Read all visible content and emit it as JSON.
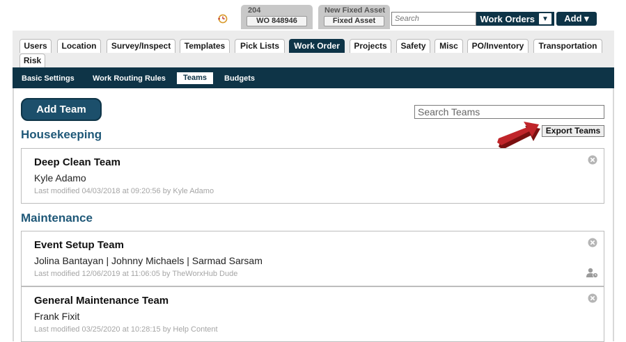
{
  "topbar": {
    "icons": {
      "history": "history-clock-icon"
    },
    "recent": [
      {
        "top": "204",
        "box": "WO 848946"
      },
      {
        "top": "New Fixed Asset",
        "box": "Fixed Asset"
      }
    ],
    "search_placeholder": "Search",
    "work_orders_label": "Work Orders",
    "work_orders_arrow": "▼",
    "add_label": "Add ▾"
  },
  "tabs": [
    {
      "label": "Users"
    },
    {
      "label": "Location"
    },
    {
      "label": "Survey/Inspect"
    },
    {
      "label": "Templates"
    },
    {
      "label": "Pick Lists"
    },
    {
      "label": "Work Order",
      "active": true
    },
    {
      "label": "Projects"
    },
    {
      "label": "Safety"
    },
    {
      "label": "Misc"
    },
    {
      "label": "PO/Inventory"
    },
    {
      "label": "Transportation"
    },
    {
      "label": "Risk"
    }
  ],
  "subnav": [
    {
      "label": "Basic Settings"
    },
    {
      "label": "Work Routing Rules"
    },
    {
      "label": "Teams",
      "active": true
    },
    {
      "label": "Budgets"
    }
  ],
  "content": {
    "add_team_label": "Add Team",
    "search_placeholder": "Search Teams",
    "export_label": "Export Teams",
    "colors": {
      "accent": "#0e3447",
      "section_title": "#1f5878",
      "arrow": "#b31e1e"
    },
    "sections": [
      {
        "title": "Housekeeping",
        "teams": [
          {
            "name": "Deep Clean Team",
            "members": "Kyle Adamo",
            "modified": "Last modified 04/03/2018 at 09:20:56 by Kyle Adamo",
            "user_icon": false
          }
        ]
      },
      {
        "title": "Maintenance",
        "teams": [
          {
            "name": "Event Setup Team",
            "members": "Jolina Bantayan | Johnny Michaels | Sarmad Sarsam",
            "modified": "Last modified 12/06/2019 at 11:06:05 by TheWorxHub Dude",
            "user_icon": true
          },
          {
            "name": "General Maintenance Team",
            "members": "Frank Fixit",
            "modified": "Last modified 03/25/2020 at 10:28:15 by Help Content",
            "user_icon": false
          }
        ]
      }
    ]
  }
}
